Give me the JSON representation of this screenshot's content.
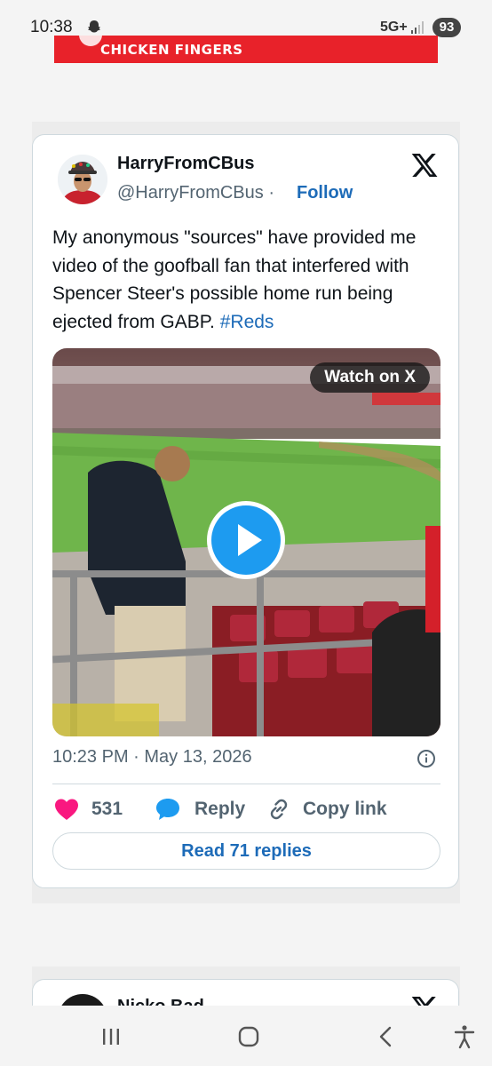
{
  "status_bar": {
    "time": "10:38",
    "network": "5G+",
    "battery": "93"
  },
  "ad": {
    "text": "CHICKEN FINGERS"
  },
  "tweet": {
    "author_name": "HarryFromCBus",
    "handle": "@HarryFromCBus",
    "separator": "·",
    "follow_label": "Follow",
    "text": "My anonymous \"sources\" have provided me video of the goofball fan that interfered with Spencer Steer's possible home run being ejected from GABP.",
    "hashtag": "#Reds",
    "media": {
      "watch_label": "Watch on X",
      "play_icon": "play-icon"
    },
    "timestamp": "10:23 PM · May 13, 2026",
    "likes": "531",
    "reply_label": "Reply",
    "copy_link_label": "Copy link",
    "read_replies_label": "Read 71 replies"
  },
  "next_tweet": {
    "author_name": "Nicko Bad"
  },
  "nav_bar": {
    "icons": [
      "recent-apps-icon",
      "home-icon",
      "back-icon",
      "accessibility-icon"
    ]
  },
  "colors": {
    "link": "#1d6bb8",
    "like": "#f91880",
    "reply": "#1d9bf0",
    "ad": "#e8222a",
    "play": "#1d9bf0"
  }
}
